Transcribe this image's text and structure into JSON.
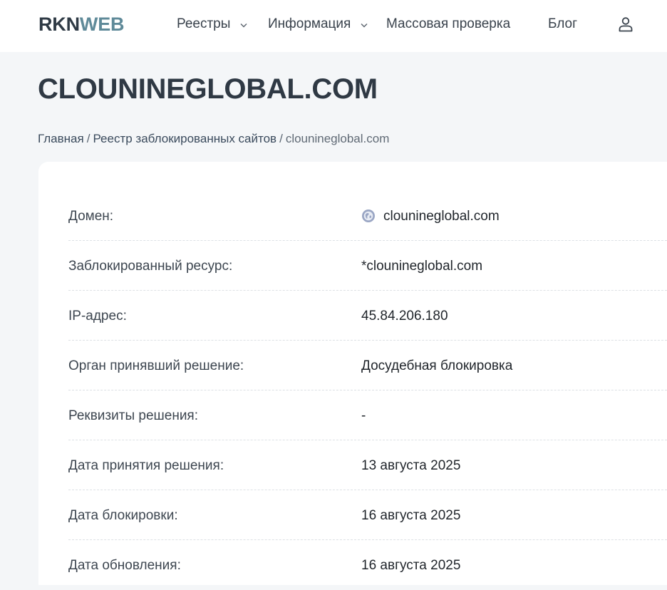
{
  "header": {
    "logo_part1": "RKN",
    "logo_part2": "WEB",
    "nav": {
      "registries": "Реестры",
      "info": "Информация",
      "bulk_check": "Массовая проверка",
      "blog": "Блог"
    },
    "colors": {
      "logo_dark": "#2f3a45",
      "logo_accent": "#5f8a99"
    }
  },
  "page": {
    "title": "CLOUNINEGLOBAL.COM"
  },
  "breadcrumb": {
    "home": "Главная",
    "separator": "/",
    "registry": "Реестр заблокированных сайтов",
    "current": "cloun­ineglobal.com"
  },
  "details": [
    {
      "label": "Домен:",
      "value": "clounineglobal.com",
      "icon": "globe-icon"
    },
    {
      "label": "Заблокированный ресурс:",
      "value": "*clounineglobal.com"
    },
    {
      "label": "IP-адрес:",
      "value": "45.84.206.180"
    },
    {
      "label": "Орган принявший решение:",
      "value": "Досудебная блокировка"
    },
    {
      "label": "Реквизиты решения:",
      "value": "-"
    },
    {
      "label": "Дата принятия решения:",
      "value": "13 августа 2025"
    },
    {
      "label": "Дата блокировки:",
      "value": "16 августа 2025"
    },
    {
      "label": "Дата обновления:",
      "value": "16 августа 2025"
    }
  ]
}
